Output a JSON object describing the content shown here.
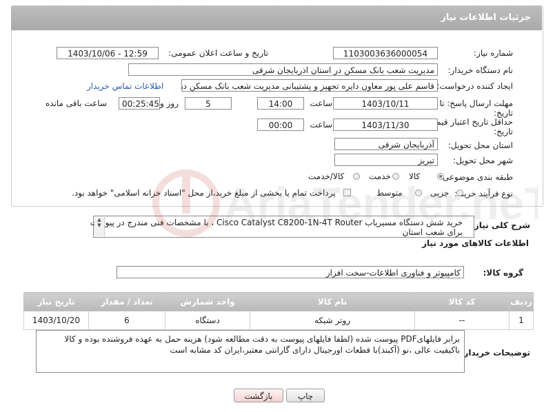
{
  "header": {
    "title": "جزئیات اطلاعات نیاز"
  },
  "labels": {
    "need_number": "شماره نیاز:",
    "announce_datetime": "تاریخ و ساعت اعلان عمومی:",
    "buyer_org": "نام دستگاه خریدار:",
    "requester": "ایجاد کننده درخواست:",
    "send_deadline": "مهلت ارسال پاسخ: تا",
    "send_deadline_2": "تاریخ:",
    "time_word": "ساعت",
    "day_word": "روز و",
    "remaining": "ساعت باقی مانده",
    "validity": "حداقل تاریخ اعتبار قیمت: تا",
    "validity_2": "تاریخ:",
    "province": "استان محل تحویل:",
    "city": "شهر محل تحویل:",
    "category": "طبقه بندی موضوعی:",
    "process": "نوع فرآیند خرید :",
    "general_desc": "شرح کلی نیاز:",
    "goods_info": "اطلاعات کالاهای مورد نیاز",
    "goods_group": "گروه کالا:",
    "buyer_notes": "توضیحات خریدار:"
  },
  "fields": {
    "need_number": "1103003636000054",
    "announce_datetime": "1403/10/06 - 12:59",
    "buyer_org": "مدیریت شعب بانک مسکن در استان اذربایجان شرقی",
    "requester": "قاسم علی پور معاون دایره تجهیز و پشتیبانی مدیریت شعب بانک مسکن در استا",
    "contact_link": "اطلاعات تماس خریدار",
    "deadline_date": "1403/10/11",
    "deadline_time": "14:00",
    "deadline_days": "5",
    "deadline_remaining": "00:25:45",
    "validity_date": "1403/11/30",
    "validity_time": "00:00",
    "province": "آذربایجان شرقی",
    "city": "تبریز",
    "goods_group": "کامپیوتر و فناوری اطلاعات-سخت افزار"
  },
  "category_options": [
    {
      "label": "کالا",
      "selected": true
    },
    {
      "label": "خدمت",
      "selected": false
    },
    {
      "label": "کالا/خدمت",
      "selected": false
    }
  ],
  "process_options": [
    {
      "label": "جزیی",
      "selected": false
    },
    {
      "label": "متوسط",
      "selected": false
    }
  ],
  "process_note": "پرداخت تمام یا بخشی از مبلغ خرید،از محل \"اسناد خزانه اسلامی\" خواهد بود.",
  "general_desc_line1": "خرید شش دستگاه مسیریاب Cisco Catalyst C8200-1N-4T Router ، با مشخصات فنی مندرج در پیوست",
  "general_desc_line2": "برای شعب استان",
  "table": {
    "headers": [
      "ردیف",
      "کد کالا",
      "نام کالا",
      "واحد شمارش",
      "تعداد / مقدار",
      "تاریخ نیاز"
    ],
    "rows": [
      [
        "1",
        "--",
        "روتر شبکه",
        "دستگاه",
        "6",
        "1403/10/20"
      ]
    ]
  },
  "buyer_notes_text": "برابر فایلهایPDF پیوست شده (لطفا فایلهای پیوست به دقت مطالعه شود) هزینه حمل به عهده فروشنده بوده و کالا باکیفیت عالی ،نو (آکبند)با قطعات اورجینال دارای گارانتی معتبر،ایران کد مشابه است",
  "buttons": {
    "print": "چاپ",
    "back": "بازگشت"
  },
  "watermark": "AriaTender.neT"
}
